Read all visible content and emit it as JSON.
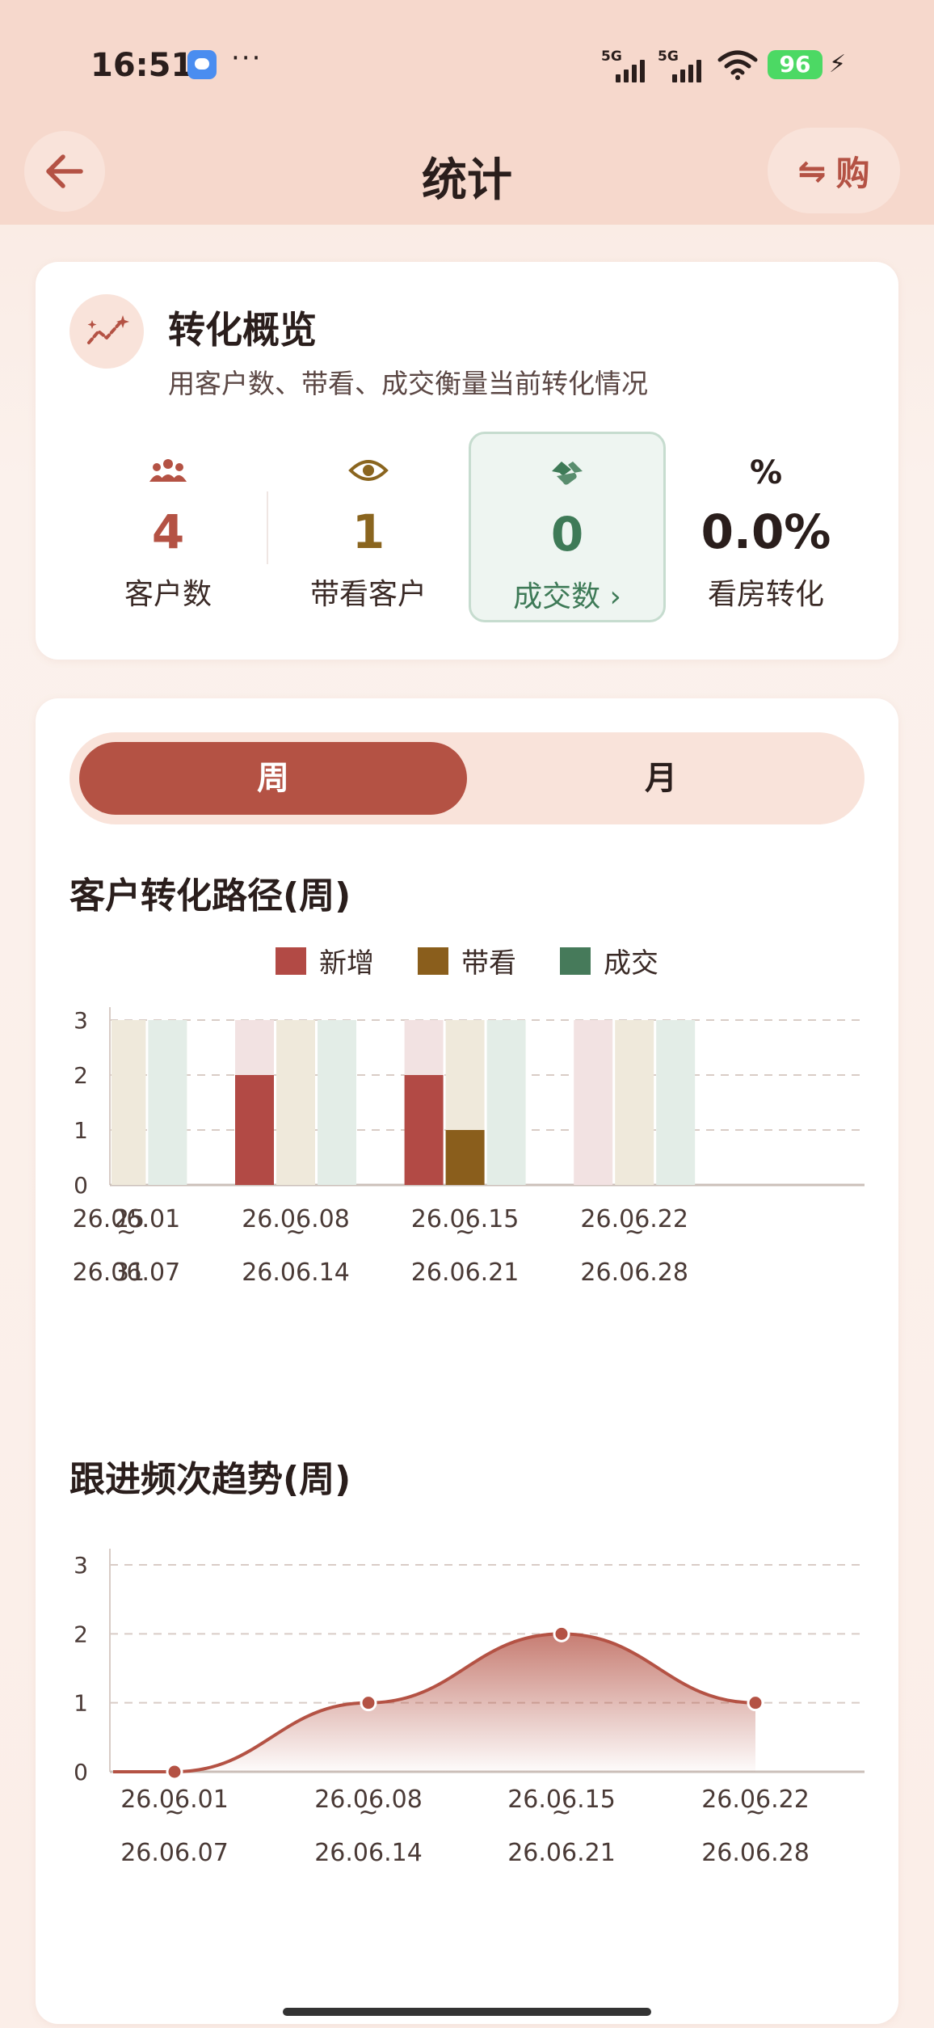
{
  "status_bar": {
    "time": "16:51",
    "dots": "···",
    "signal1": "5G",
    "signal2": "5G",
    "battery": "96"
  },
  "header": {
    "title": "统计",
    "switch_icon": "⇋",
    "switch_label": "购"
  },
  "overview": {
    "title": "转化概览",
    "subtitle": "用客户数、带看、成交衡量当前转化情况",
    "metrics": [
      {
        "icon": "people-icon",
        "value": "4",
        "label": "客户数",
        "color": "#b45244"
      },
      {
        "icon": "eye-icon",
        "value": "1",
        "label": "带看客户",
        "color": "#8a651f"
      },
      {
        "icon": "handshake-icon",
        "value": "0",
        "label": "成交数 ›",
        "color": "#3e7a57"
      },
      {
        "icon": "percent-icon",
        "value": "0.0%",
        "label": "看房转化",
        "color": "#2a1e1c",
        "icon_text": "%"
      }
    ]
  },
  "tabs": {
    "week": "周",
    "month": "月"
  },
  "bar_section": {
    "title": "客户转化路径(周)"
  },
  "line_section": {
    "title": "跟进频次趋势(周)"
  },
  "colors": {
    "new": "#b24a45",
    "visit": "#8a5e1c",
    "deal": "#467a5a",
    "line": "#b45244"
  },
  "chart_data": [
    {
      "type": "bar",
      "title": "客户转化路径(周)",
      "legend": [
        "新增",
        "带看",
        "成交"
      ],
      "legend_position": "top-center",
      "categories": [
        [
          "25",
          "31"
        ],
        [
          "26.06.01",
          "~",
          "26.06.07"
        ],
        [
          "26.06.08",
          "~",
          "26.06.14"
        ],
        [
          "26.06.15",
          "~",
          "26.06.21"
        ],
        [
          "26.06.22",
          "~",
          "26.06.28"
        ]
      ],
      "series": [
        {
          "name": "新增",
          "values": [
            0,
            0,
            2,
            2,
            0
          ]
        },
        {
          "name": "带看",
          "values": [
            0,
            0,
            0,
            1,
            0
          ]
        },
        {
          "name": "成交",
          "values": [
            0,
            0,
            0,
            0,
            0
          ]
        }
      ],
      "ylim": [
        0,
        3
      ],
      "yticks": [
        "0",
        "1",
        "2",
        "3"
      ],
      "grid": true
    },
    {
      "type": "area",
      "title": "跟进频次趋势(周)",
      "categories": [
        [
          "26.06.01",
          "~",
          "26.06.07"
        ],
        [
          "26.06.08",
          "~",
          "26.06.14"
        ],
        [
          "26.06.15",
          "~",
          "26.06.21"
        ],
        [
          "26.06.22",
          "~",
          "26.06.28"
        ]
      ],
      "series": [
        {
          "values": [
            0,
            1,
            2,
            1
          ]
        }
      ],
      "ylim": [
        0,
        3
      ],
      "yticks": [
        "0",
        "1",
        "2",
        "3"
      ],
      "grid": true
    }
  ]
}
